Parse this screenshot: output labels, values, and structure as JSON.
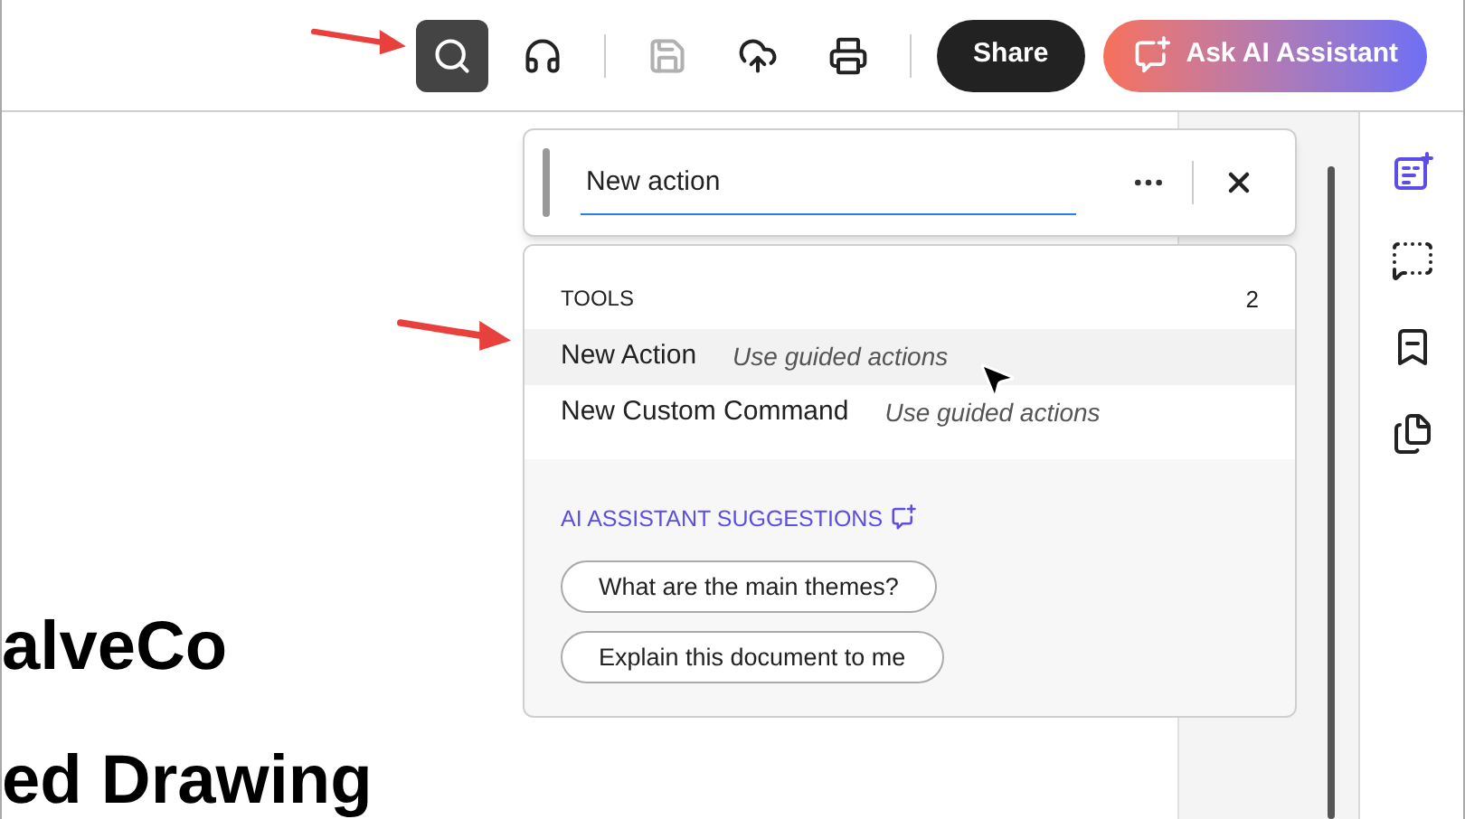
{
  "toolbar": {
    "tools": [
      {
        "selected": true,
        "disabled": false
      },
      {
        "selected": false,
        "disabled": false
      },
      {
        "selected": false,
        "disabled": true
      },
      {
        "selected": false,
        "disabled": false
      },
      {
        "selected": false,
        "disabled": false
      }
    ],
    "share": "Share",
    "ai_button": "Ask AI Assistant"
  },
  "search": {
    "value": "New action"
  },
  "results": {
    "section": "TOOLS",
    "count": "2",
    "items": [
      {
        "label": "New Action",
        "hint": "Use guided actions",
        "selected": true
      },
      {
        "label": "New Custom Command",
        "hint": "Use guided actions",
        "selected": false
      }
    ],
    "ai_title": "AI ASSISTANT SUGGESTIONS",
    "suggestions": [
      "What are the main themes?",
      "Explain this document to me"
    ]
  },
  "document": {
    "headings": [
      "alveCo",
      "ed Drawing"
    ]
  },
  "right_rail": {
    "tools": [
      {
        "selected": true
      },
      {
        "selected": false
      },
      {
        "selected": false
      },
      {
        "selected": false
      }
    ]
  }
}
